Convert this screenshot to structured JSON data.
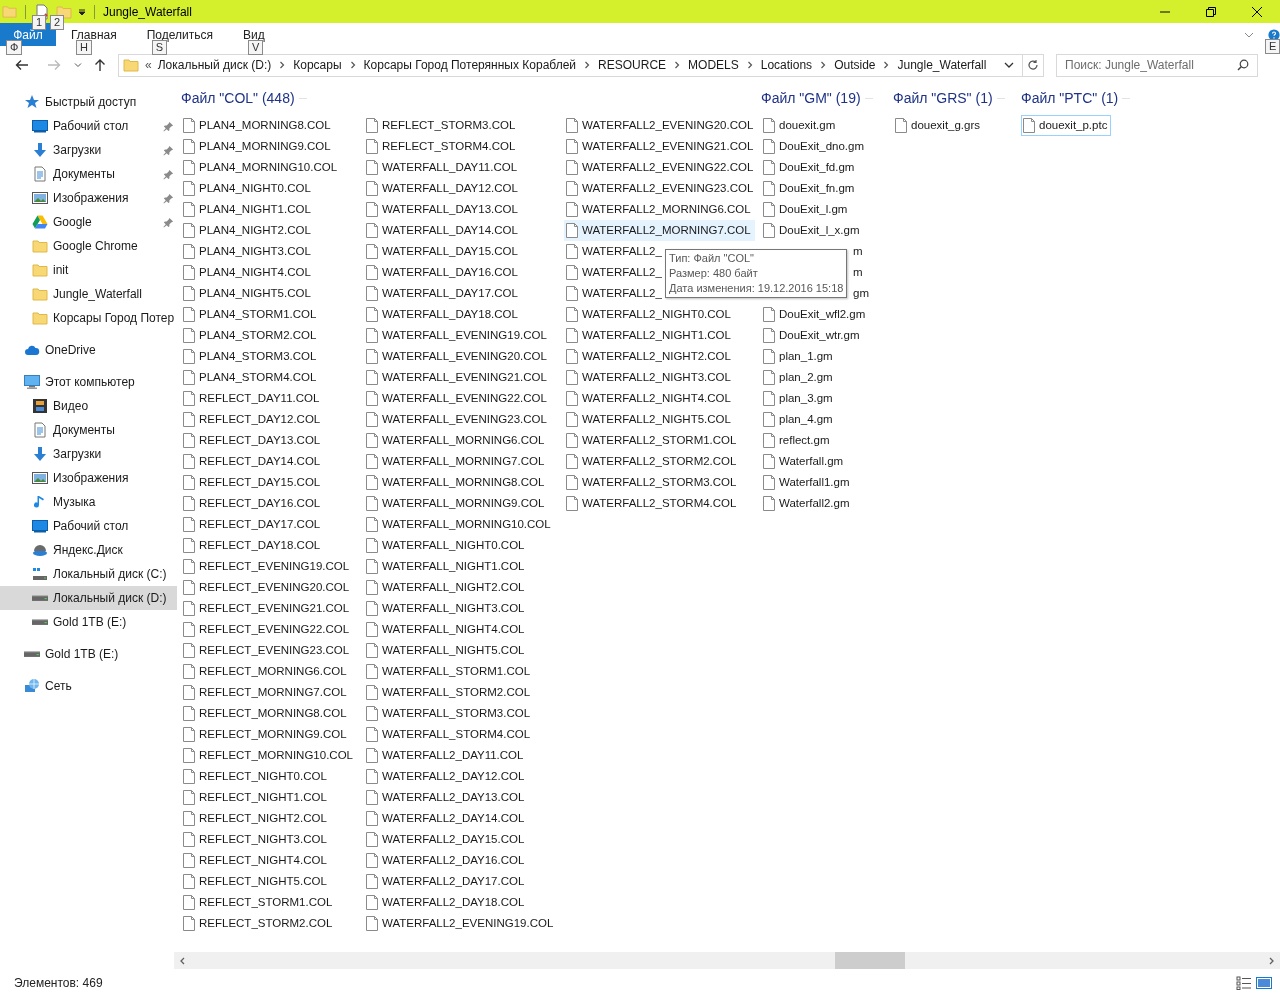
{
  "window": {
    "title": "Jungle_Waterfall",
    "quick_access_keytips": [
      "1",
      "2"
    ]
  },
  "ribbon": {
    "tabs": [
      {
        "label": "Файл",
        "kind": "file",
        "keytip": "Ф",
        "selected": false
      },
      {
        "label": "Главная",
        "kind": "tab",
        "keytip": "H",
        "selected": false
      },
      {
        "label": "Поделиться",
        "kind": "tab",
        "keytip": "S",
        "selected": false
      },
      {
        "label": "Вид",
        "kind": "tab",
        "keytip": "V",
        "selected": false
      }
    ],
    "help_keytip": "E"
  },
  "address_bar": {
    "overflow": "«",
    "crumbs": [
      "Локальный диск (D:)",
      "Корсары",
      "Корсары Город Потерянных Кораблей",
      "RESOURCE",
      "MODELS",
      "Locations",
      "Outside",
      "Jungle_Waterfall"
    ]
  },
  "search": {
    "placeholder": "Поиск: Jungle_Waterfall"
  },
  "navigation": [
    {
      "label": "Быстрый доступ",
      "kind": "star",
      "selected": false,
      "children": [
        {
          "label": "Рабочий стол",
          "kind": "desktop",
          "pinned": true,
          "selected": false
        },
        {
          "label": "Загрузки",
          "kind": "download",
          "pinned": true,
          "selected": false
        },
        {
          "label": "Документы",
          "kind": "docs",
          "pinned": true,
          "selected": false
        },
        {
          "label": "Изображения",
          "kind": "pictures",
          "pinned": true,
          "selected": false
        },
        {
          "label": "Google",
          "kind": "gdrive",
          "pinned": true,
          "selected": false
        },
        {
          "label": "Google Chrome",
          "kind": "folder",
          "pinned": false,
          "selected": false
        },
        {
          "label": "init",
          "kind": "folder",
          "pinned": false,
          "selected": false
        },
        {
          "label": "Jungle_Waterfall",
          "kind": "folder",
          "pinned": false,
          "selected": false
        },
        {
          "label": "Корсары Город Потер",
          "kind": "folder",
          "pinned": false,
          "selected": false
        }
      ]
    },
    {
      "label": "OneDrive",
      "kind": "cloud",
      "selected": false
    },
    {
      "label": "Этот компьютер",
      "kind": "pc",
      "selected": false,
      "children": [
        {
          "label": "Видео",
          "kind": "video",
          "selected": false
        },
        {
          "label": "Документы",
          "kind": "docs",
          "selected": false
        },
        {
          "label": "Загрузки",
          "kind": "download",
          "selected": false
        },
        {
          "label": "Изображения",
          "kind": "pictures",
          "selected": false
        },
        {
          "label": "Музыка",
          "kind": "music",
          "selected": false
        },
        {
          "label": "Рабочий стол",
          "kind": "desktop",
          "selected": false
        },
        {
          "label": "Яндекс.Диск",
          "kind": "yadisk",
          "selected": false
        },
        {
          "label": "Локальный диск (C:)",
          "kind": "drive-win",
          "selected": false
        },
        {
          "label": "Локальный диск (D:)",
          "kind": "drive",
          "selected": true
        },
        {
          "label": "Gold 1TB (E:)",
          "kind": "drive",
          "selected": false
        }
      ]
    },
    {
      "label": "Gold 1TB (E:)",
      "kind": "drive",
      "selected": false
    },
    {
      "label": "Сеть",
      "kind": "network",
      "selected": false
    }
  ],
  "groups": [
    {
      "title": "Файл \"COL\" (448)",
      "columns": [
        [
          {
            "name": "PLAN4_MORNING8.COL"
          },
          {
            "name": "PLAN4_MORNING9.COL"
          },
          {
            "name": "PLAN4_MORNING10.COL"
          },
          {
            "name": "PLAN4_NIGHT0.COL"
          },
          {
            "name": "PLAN4_NIGHT1.COL"
          },
          {
            "name": "PLAN4_NIGHT2.COL"
          },
          {
            "name": "PLAN4_NIGHT3.COL"
          },
          {
            "name": "PLAN4_NIGHT4.COL"
          },
          {
            "name": "PLAN4_NIGHT5.COL"
          },
          {
            "name": "PLAN4_STORM1.COL"
          },
          {
            "name": "PLAN4_STORM2.COL"
          },
          {
            "name": "PLAN4_STORM3.COL"
          },
          {
            "name": "PLAN4_STORM4.COL"
          },
          {
            "name": "REFLECT_DAY11.COL"
          },
          {
            "name": "REFLECT_DAY12.COL"
          },
          {
            "name": "REFLECT_DAY13.COL"
          },
          {
            "name": "REFLECT_DAY14.COL"
          },
          {
            "name": "REFLECT_DAY15.COL"
          },
          {
            "name": "REFLECT_DAY16.COL"
          },
          {
            "name": "REFLECT_DAY17.COL"
          },
          {
            "name": "REFLECT_DAY18.COL"
          },
          {
            "name": "REFLECT_EVENING19.COL"
          },
          {
            "name": "REFLECT_EVENING20.COL"
          },
          {
            "name": "REFLECT_EVENING21.COL"
          },
          {
            "name": "REFLECT_EVENING22.COL"
          },
          {
            "name": "REFLECT_EVENING23.COL"
          },
          {
            "name": "REFLECT_MORNING6.COL"
          },
          {
            "name": "REFLECT_MORNING7.COL"
          },
          {
            "name": "REFLECT_MORNING8.COL"
          },
          {
            "name": "REFLECT_MORNING9.COL"
          },
          {
            "name": "REFLECT_MORNING10.COL"
          },
          {
            "name": "REFLECT_NIGHT0.COL"
          },
          {
            "name": "REFLECT_NIGHT1.COL"
          },
          {
            "name": "REFLECT_NIGHT2.COL"
          },
          {
            "name": "REFLECT_NIGHT3.COL"
          },
          {
            "name": "REFLECT_NIGHT4.COL"
          },
          {
            "name": "REFLECT_NIGHT5.COL"
          },
          {
            "name": "REFLECT_STORM1.COL"
          },
          {
            "name": "REFLECT_STORM2.COL"
          }
        ],
        [
          {
            "name": "REFLECT_STORM3.COL"
          },
          {
            "name": "REFLECT_STORM4.COL"
          },
          {
            "name": "WATERFALL_DAY11.COL"
          },
          {
            "name": "WATERFALL_DAY12.COL"
          },
          {
            "name": "WATERFALL_DAY13.COL"
          },
          {
            "name": "WATERFALL_DAY14.COL"
          },
          {
            "name": "WATERFALL_DAY15.COL"
          },
          {
            "name": "WATERFALL_DAY16.COL"
          },
          {
            "name": "WATERFALL_DAY17.COL"
          },
          {
            "name": "WATERFALL_DAY18.COL"
          },
          {
            "name": "WATERFALL_EVENING19.COL"
          },
          {
            "name": "WATERFALL_EVENING20.COL"
          },
          {
            "name": "WATERFALL_EVENING21.COL"
          },
          {
            "name": "WATERFALL_EVENING22.COL"
          },
          {
            "name": "WATERFALL_EVENING23.COL"
          },
          {
            "name": "WATERFALL_MORNING6.COL"
          },
          {
            "name": "WATERFALL_MORNING7.COL"
          },
          {
            "name": "WATERFALL_MORNING8.COL"
          },
          {
            "name": "WATERFALL_MORNING9.COL"
          },
          {
            "name": "WATERFALL_MORNING10.COL"
          },
          {
            "name": "WATERFALL_NIGHT0.COL"
          },
          {
            "name": "WATERFALL_NIGHT1.COL"
          },
          {
            "name": "WATERFALL_NIGHT2.COL"
          },
          {
            "name": "WATERFALL_NIGHT3.COL"
          },
          {
            "name": "WATERFALL_NIGHT4.COL"
          },
          {
            "name": "WATERFALL_NIGHT5.COL"
          },
          {
            "name": "WATERFALL_STORM1.COL"
          },
          {
            "name": "WATERFALL_STORM2.COL"
          },
          {
            "name": "WATERFALL_STORM3.COL"
          },
          {
            "name": "WATERFALL_STORM4.COL"
          },
          {
            "name": "WATERFALL2_DAY11.COL"
          },
          {
            "name": "WATERFALL2_DAY12.COL"
          },
          {
            "name": "WATERFALL2_DAY13.COL"
          },
          {
            "name": "WATERFALL2_DAY14.COL"
          },
          {
            "name": "WATERFALL2_DAY15.COL"
          },
          {
            "name": "WATERFALL2_DAY16.COL"
          },
          {
            "name": "WATERFALL2_DAY17.COL"
          },
          {
            "name": "WATERFALL2_DAY18.COL"
          },
          {
            "name": "WATERFALL2_EVENING19.COL"
          }
        ],
        [
          {
            "name": "WATERFALL2_EVENING20.COL"
          },
          {
            "name": "WATERFALL2_EVENING21.COL"
          },
          {
            "name": "WATERFALL2_EVENING22.COL"
          },
          {
            "name": "WATERFALL2_EVENING23.COL"
          },
          {
            "name": "WATERFALL2_MORNING6.COL"
          },
          {
            "name": "WATERFALL2_MORNING7.COL",
            "hovered": true
          },
          {
            "name": "WATERFALL2_"
          },
          {
            "name": "WATERFALL2_"
          },
          {
            "name": "WATERFALL2_"
          },
          {
            "name": "WATERFALL2_NIGHT0.COL"
          },
          {
            "name": "WATERFALL2_NIGHT1.COL"
          },
          {
            "name": "WATERFALL2_NIGHT2.COL"
          },
          {
            "name": "WATERFALL2_NIGHT3.COL"
          },
          {
            "name": "WATERFALL2_NIGHT4.COL"
          },
          {
            "name": "WATERFALL2_NIGHT5.COL"
          },
          {
            "name": "WATERFALL2_STORM1.COL"
          },
          {
            "name": "WATERFALL2_STORM2.COL"
          },
          {
            "name": "WATERFALL2_STORM3.COL"
          },
          {
            "name": "WATERFALL2_STORM4.COL"
          }
        ]
      ]
    },
    {
      "title": "Файл \"GM\" (19)",
      "columns": [
        [
          {
            "name": "douexit.gm"
          },
          {
            "name": "DouExit_dno.gm"
          },
          {
            "name": "DouExit_fd.gm"
          },
          {
            "name": "DouExit_fn.gm"
          },
          {
            "name": "DouExit_l.gm"
          },
          {
            "name": "DouExit_l_x.gm"
          },
          {
            "name": "m",
            "kind": "partial"
          },
          {
            "name": "m",
            "kind": "partial"
          },
          {
            "name": "gm",
            "kind": "partial"
          },
          {
            "name": "DouExit_wfl2.gm"
          },
          {
            "name": "DouExit_wtr.gm"
          },
          {
            "name": "plan_1.gm"
          },
          {
            "name": "plan_2.gm"
          },
          {
            "name": "plan_3.gm"
          },
          {
            "name": "plan_4.gm"
          },
          {
            "name": "reflect.gm"
          },
          {
            "name": "Waterfall.gm"
          },
          {
            "name": "Waterfall1.gm"
          },
          {
            "name": "Waterfall2.gm"
          }
        ]
      ]
    },
    {
      "title": "Файл \"GRS\" (1)",
      "columns": [
        [
          {
            "name": "douexit_g.grs"
          }
        ]
      ]
    },
    {
      "title": "Файл \"PTC\" (1)",
      "columns": [
        [
          {
            "name": "douexit_p.ptc",
            "focused": true
          }
        ]
      ]
    }
  ],
  "tooltip": [
    "Тип: Файл \"COL\"",
    "Размер: 480 байт",
    "Дата изменения: 19.12.2016 15:18"
  ],
  "status_bar": {
    "item_count": "Элементов: 469"
  }
}
